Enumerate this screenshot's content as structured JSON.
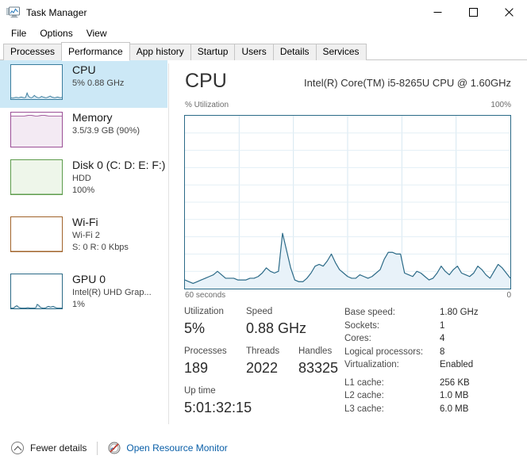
{
  "window": {
    "title": "Task Manager",
    "icon": "task-manager-icon",
    "controls": {
      "minimize": "–",
      "maximize": "☐",
      "close": "✕"
    }
  },
  "menu": {
    "items": [
      {
        "label": "File"
      },
      {
        "label": "Options"
      },
      {
        "label": "View"
      }
    ]
  },
  "tabs": {
    "active": "Performance",
    "items": [
      {
        "label": "Processes"
      },
      {
        "label": "Performance"
      },
      {
        "label": "App history"
      },
      {
        "label": "Startup"
      },
      {
        "label": "Users"
      },
      {
        "label": "Details"
      },
      {
        "label": "Services"
      }
    ]
  },
  "sidebar": {
    "items": [
      {
        "name": "CPU",
        "line2": "5%  0.88 GHz",
        "line3": "",
        "selected": true,
        "accent": "#3a7d9e",
        "fill": "#d6e9f4"
      },
      {
        "name": "Memory",
        "line2": "3.5/3.9 GB (90%)",
        "line3": "",
        "selected": false,
        "accent": "#9b4f96",
        "fill": "#f6eff6"
      },
      {
        "name": "Disk 0 (C: D: E: F:)",
        "line2": "HDD",
        "line3": "100%",
        "selected": false,
        "accent": "#4f8a3d",
        "fill": "#eaf4e6"
      },
      {
        "name": "Wi-Fi",
        "line2": "Wi-Fi 2",
        "line3": "S: 0 R: 0 Kbps",
        "selected": false,
        "accent": "#a0632a",
        "fill": "#ffffff"
      },
      {
        "name": "GPU 0",
        "line2": "Intel(R) UHD Grap...",
        "line3": "1%",
        "selected": false,
        "accent": "#2b6a87",
        "fill": "#ffffff"
      }
    ]
  },
  "detail": {
    "title": "CPU",
    "model": "Intel(R) Core(TM) i5-8265U CPU @ 1.60GHz",
    "graph_axis_top_left": "% Utilization",
    "graph_axis_top_right": "100%",
    "graph_axis_bottom_left": "60 seconds",
    "graph_axis_bottom_right": "0",
    "graph_line_color": "#2b6a87",
    "graph_fill_color": "#e8f2f9",
    "stats": {
      "utilization_label": "Utilization",
      "utilization_value": "5%",
      "speed_label": "Speed",
      "speed_value": "0.88 GHz",
      "processes_label": "Processes",
      "processes_value": "189",
      "threads_label": "Threads",
      "threads_value": "2022",
      "handles_label": "Handles",
      "handles_value": "83325",
      "uptime_label": "Up time",
      "uptime_value": "5:01:32:15"
    },
    "specs": [
      {
        "key": "Base speed:",
        "value": "1.80 GHz"
      },
      {
        "key": "Sockets:",
        "value": "1"
      },
      {
        "key": "Cores:",
        "value": "4"
      },
      {
        "key": "Logical processors:",
        "value": "8"
      },
      {
        "key": "Virtualization:",
        "value": "Enabled"
      },
      {
        "key": "L1 cache:",
        "value": "256 KB"
      },
      {
        "key": "L2 cache:",
        "value": "1.0 MB"
      },
      {
        "key": "L3 cache:",
        "value": "6.0 MB"
      }
    ]
  },
  "footer": {
    "fewer_details": "Fewer details",
    "resource_monitor": "Open Resource Monitor",
    "link_color": "#0a5fa8"
  },
  "chart_data": {
    "type": "area",
    "title": "CPU % Utilization",
    "xlabel": "60 seconds",
    "ylabel": "% Utilization",
    "ylim": [
      0,
      100
    ],
    "xlim": [
      60,
      0
    ],
    "grid": true,
    "grid_cols": 6,
    "grid_rows": 10,
    "line_color": "#2b6a87",
    "fill_color": "#e8f2f9",
    "series": [
      {
        "name": "CPU utilization",
        "values": [
          5,
          4,
          3,
          4,
          5,
          6,
          7,
          8,
          10,
          8,
          6,
          6,
          6,
          5,
          5,
          5,
          6,
          6,
          7,
          9,
          12,
          10,
          9,
          10,
          32,
          22,
          12,
          5,
          4,
          4,
          6,
          9,
          13,
          14,
          13,
          16,
          20,
          15,
          11,
          9,
          7,
          6,
          6,
          8,
          7,
          6,
          7,
          9,
          11,
          17,
          21,
          21,
          20,
          20,
          9,
          8,
          7,
          10,
          9,
          7,
          5,
          6,
          9,
          13,
          10,
          8,
          11,
          13,
          9,
          8,
          7,
          9,
          13,
          11,
          8,
          6,
          10,
          14,
          12,
          9,
          6
        ]
      }
    ]
  },
  "mini_charts": {
    "cpu": [
      4,
      3,
      4,
      5,
      5,
      4,
      5,
      6,
      5,
      4,
      5,
      18,
      8,
      5,
      4,
      6,
      11,
      7,
      5,
      4,
      5,
      8,
      6,
      5,
      4,
      5,
      7,
      9,
      6,
      5,
      4,
      5,
      6,
      5,
      4,
      5
    ],
    "memory_level": 90,
    "memory_wave": [
      90,
      90,
      90,
      90,
      90,
      90,
      90,
      91,
      92,
      92,
      91,
      90,
      90,
      91,
      92,
      92,
      91,
      90,
      90,
      90,
      90,
      90,
      90,
      90
    ],
    "disk_level": 0,
    "wifi_level": 0,
    "gpu": [
      1,
      1,
      2,
      6,
      8,
      4,
      2,
      1,
      1,
      1,
      1,
      2,
      2,
      1,
      1,
      1,
      1,
      2,
      12,
      9,
      4,
      2,
      1,
      1,
      2,
      5,
      6,
      4,
      5,
      6,
      4,
      2,
      1,
      1,
      1,
      1
    ]
  }
}
